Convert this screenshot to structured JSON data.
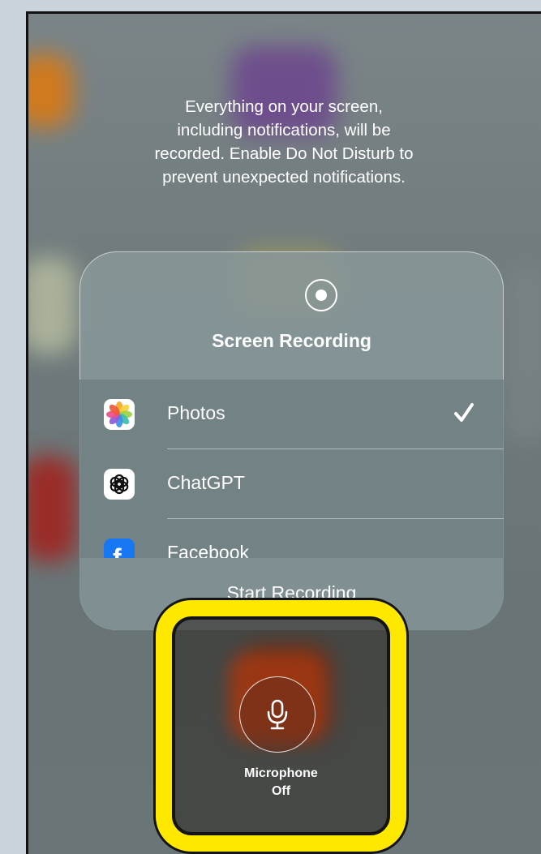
{
  "notice": {
    "line1": "Everything on your screen,",
    "line2": "including notifications, will be",
    "line3": "recorded. Enable Do Not Disturb to",
    "line4": "prevent unexpected notifications."
  },
  "panel": {
    "title": "Screen Recording",
    "destinations": [
      {
        "label": "Photos",
        "icon": "photos-app-icon",
        "selected": true
      },
      {
        "label": "ChatGPT",
        "icon": "chatgpt-app-icon",
        "selected": false
      },
      {
        "label": "Facebook",
        "icon": "facebook-app-icon",
        "selected": false
      }
    ],
    "start_label": "Start Recording"
  },
  "microphone": {
    "line1": "Microphone",
    "line2": "Off",
    "icon": "microphone-icon"
  },
  "colors": {
    "highlight": "#ffe800",
    "facebook": "#1877f2"
  }
}
